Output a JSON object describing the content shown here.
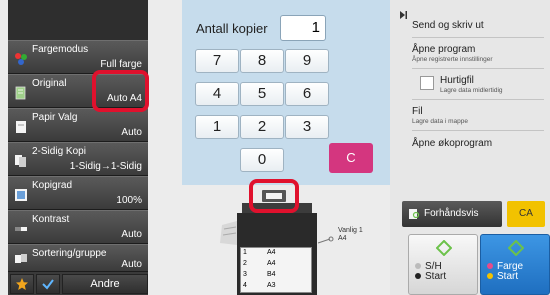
{
  "copy_count": {
    "label": "Antall kopier",
    "value": "1"
  },
  "settings": [
    {
      "label": "Fargemodus",
      "value": "Full farge",
      "icon": "color-mode-icon"
    },
    {
      "label": "Original",
      "value": "Auto A4",
      "icon": "original-icon"
    },
    {
      "label": "Papir Valg",
      "value": "Auto",
      "icon": "paper-icon"
    },
    {
      "label": "2-Sidig Kopi",
      "value": "1-Sidig→1-Sidig",
      "icon": "duplex-icon"
    },
    {
      "label": "Kopigrad",
      "value": "100%",
      "icon": "zoom-icon"
    },
    {
      "label": "Kontrast",
      "value": "Auto",
      "icon": "contrast-icon"
    },
    {
      "label": "Sortering/gruppe",
      "value": "Auto",
      "icon": "sort-icon"
    }
  ],
  "bottom_bar": {
    "more_label": "Andre"
  },
  "keypad": {
    "keys": [
      "7",
      "8",
      "9",
      "4",
      "5",
      "6",
      "1",
      "2",
      "3",
      "0"
    ],
    "clear": "C"
  },
  "machine": {
    "output_paper": "Vanlig 1",
    "output_size": "A4",
    "trays": [
      {
        "num": "1",
        "size": "A4"
      },
      {
        "num": "2",
        "size": "A4"
      },
      {
        "num": "3",
        "size": "B4"
      },
      {
        "num": "4",
        "size": "A3"
      }
    ]
  },
  "right_menu": {
    "items": [
      {
        "title": "Send og skriv ut",
        "sub": ""
      },
      {
        "title": "Åpne program",
        "sub": "Åpne registrerte innstillinger"
      },
      {
        "title": "Hurtigfil",
        "sub": "Lagre data midlertidig"
      },
      {
        "title": "Fil",
        "sub": "Lagre data i mappe"
      },
      {
        "title": "Åpne økoprogram",
        "sub": ""
      }
    ]
  },
  "actions": {
    "preview": "Forhåndsvis",
    "ca": "CA",
    "bw_start_line1": "S/H",
    "bw_start_line2": "Start",
    "color_start_line1": "Farge",
    "color_start_line2": "Start"
  },
  "colors": {
    "highlight": "#e0112d",
    "clear_key": "#d4367f",
    "ca_button": "#f2c200",
    "color_start": "#2f86d8",
    "start_icon": "#6cc24a"
  }
}
